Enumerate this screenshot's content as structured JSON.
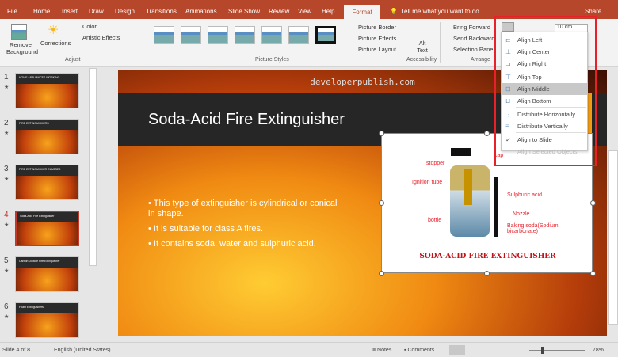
{
  "tabs": [
    "File",
    "Home",
    "Insert",
    "Draw",
    "Design",
    "Transitions",
    "Animations",
    "Slide Show",
    "Review",
    "View",
    "Help",
    "Format"
  ],
  "tell_me": "Tell me what you want to do",
  "share": "Share",
  "ribbon": {
    "remove_background": "Remove Background",
    "corrections": "Corrections",
    "color": "Color",
    "artistic_effects": "Artistic Effects",
    "adjust": "Adjust",
    "picture_styles": "Picture Styles",
    "picture_border": "Picture Border",
    "picture_effects": "Picture Effects",
    "picture_layout": "Picture Layout",
    "alt_text": "Alt Text",
    "accessibility": "Accessibility",
    "bring_forward": "Bring Forward",
    "send_backward": "Send Backward",
    "selection_pane": "Selection Pane",
    "arrange": "Arrange",
    "height_value": "10 cm"
  },
  "align_menu": {
    "items": [
      "Align Left",
      "Align Center",
      "Align Right",
      "Align Top",
      "Align Middle",
      "Align Bottom",
      "Distribute Horizontally",
      "Distribute Vertically",
      "Align to Slide",
      "Align Selected Objects"
    ],
    "highlighted": "Align Middle",
    "checked": "Align to Slide",
    "disabled": "Align Selected Objects"
  },
  "thumbnails": [
    {
      "num": "1",
      "title": "HOME APPLIANCES WORKING"
    },
    {
      "num": "2",
      "title": "FIRE EXTINGUISHERS"
    },
    {
      "num": "3",
      "title": "FIRE EXTINGUISHER CLASSES"
    },
    {
      "num": "4",
      "title": "Soda-Acid Fire Extinguisher"
    },
    {
      "num": "5",
      "title": "Carbon Dioxide Fire Extinguisher"
    },
    {
      "num": "6",
      "title": "Foam Extinguishers"
    }
  ],
  "selected_slide": "4",
  "slide": {
    "watermark": "developerpublish.com",
    "title": "Soda-Acid Fire Extinguisher",
    "bullets": [
      "This type of extinguisher is cylindrical or conical in shape.",
      "It is suitable for class A fires.",
      "It contains soda, water and sulphuric acid."
    ],
    "diagram": {
      "labels": [
        "cap",
        "stopper",
        "Ignition tube",
        "Sulphuric acid",
        "Nozzle",
        "bottle",
        "Baking soda(Sodium bicarbonate)"
      ],
      "caption": "SODA-ACID FIRE EXTINGUISHER"
    }
  },
  "status": {
    "slide": "Slide 4 of 8",
    "language": "English (United States)",
    "notes": "Notes",
    "comments": "Comments",
    "zoom": "78%"
  },
  "colors": {
    "accent": "#b7472a",
    "highlight_box": "#e8202a"
  }
}
